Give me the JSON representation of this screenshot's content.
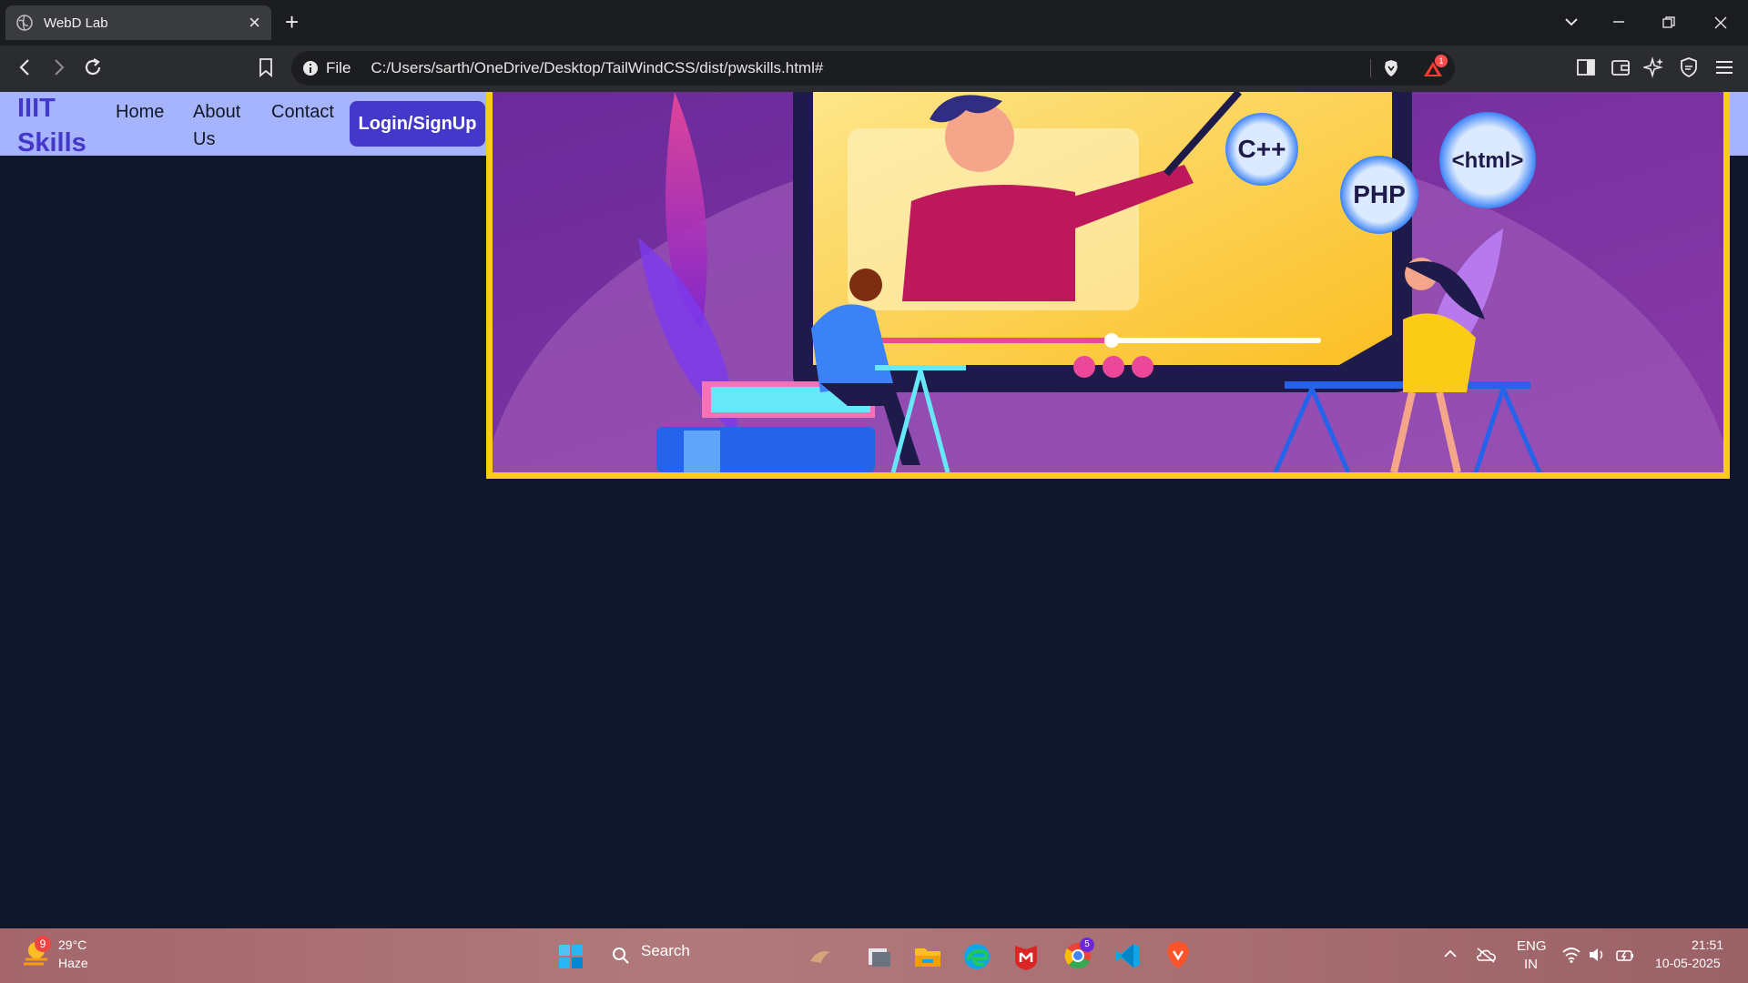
{
  "browser": {
    "tab_title": "WebD Lab",
    "address_prefix": "File",
    "url": "C:/Users/sarth/OneDrive/Desktop/TailWindCSS/dist/pwskills.html#",
    "notification_count": "1"
  },
  "page": {
    "logo_line1": "IIIT",
    "logo_line2": "Skills",
    "nav": {
      "home": "Home",
      "about_line1": "About",
      "about_line2": "Us",
      "contact": "Contact"
    },
    "login_label": "Login/SignUp",
    "hero_labels": {
      "cpp": "C++",
      "php": "PHP",
      "html": "<html>"
    },
    "colors": {
      "background": "#0f172a",
      "navbar": "#a5b4fc",
      "accent": "#4338ca",
      "hero_border": "#facc15"
    }
  },
  "taskbar": {
    "temperature": "29°C",
    "weather": "Haze",
    "weather_badge": "9",
    "search_placeholder": "Search",
    "lang_line1": "ENG",
    "lang_line2": "IN",
    "time": "21:51",
    "date": "10-05-2025",
    "chrome_badge": "5"
  }
}
